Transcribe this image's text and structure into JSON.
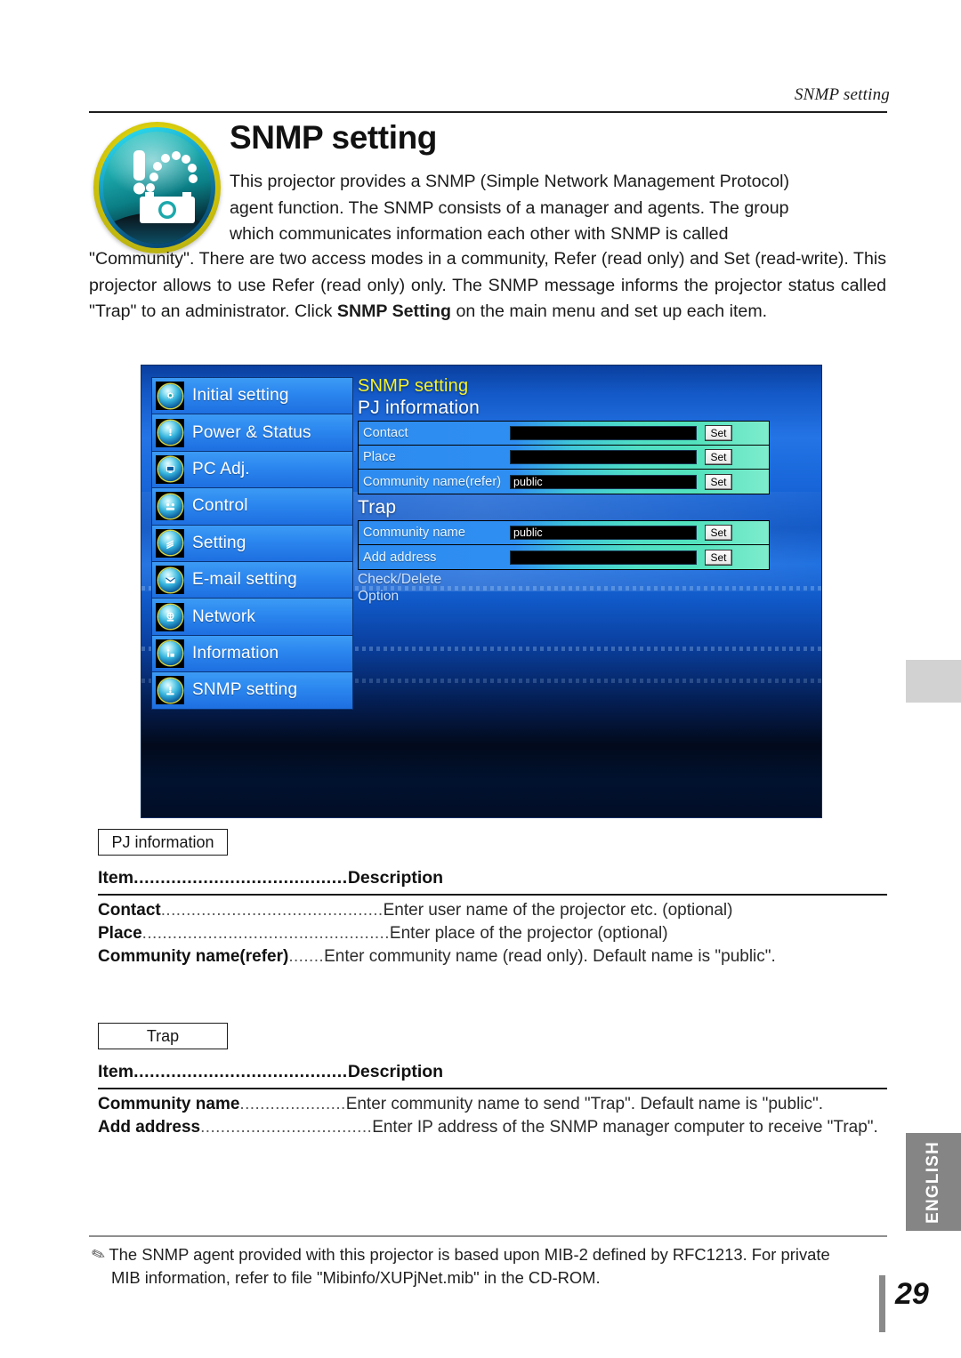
{
  "page": {
    "running_head": "SNMP setting",
    "title": "SNMP setting",
    "number": "29",
    "language_tab": "ENGLISH"
  },
  "intro": {
    "line1": "This projector provides a SNMP (Simple Network Management Protocol)",
    "line2": "agent function. The SNMP consists of a manager and agents. The group",
    "line3": "which communicates information each other with SNMP is called",
    "rest_a": "\"Community\". There are two access modes in a community, Refer (read only) and Set (read-write). This projector allows to use Refer (read only) only. The SNMP message informs the projector status called \"Trap\" to an administrator. Click ",
    "bold": "SNMP Setting",
    "rest_b": " on the main menu and set up each item."
  },
  "screenshot": {
    "sidebar": [
      {
        "label": "Initial setting",
        "icon": "gear-sun-icon"
      },
      {
        "label": "Power & Status",
        "icon": "power-status-icon"
      },
      {
        "label": "PC Adj.",
        "icon": "monitor-icon"
      },
      {
        "label": "Control",
        "icon": "control-icon"
      },
      {
        "label": "Setting",
        "icon": "sliders-icon"
      },
      {
        "label": "E-mail setting",
        "icon": "envelope-icon"
      },
      {
        "label": "Network",
        "icon": "network-icon"
      },
      {
        "label": "Information",
        "icon": "info-icon"
      },
      {
        "label": "SNMP setting",
        "icon": "snmp-icon"
      }
    ],
    "panel_title": "SNMP setting",
    "sections": [
      {
        "heading": "PJ information",
        "rows": [
          {
            "label": "Contact",
            "value": "",
            "button": "Set"
          },
          {
            "label": "Place",
            "value": "",
            "button": "Set"
          },
          {
            "label": "Community name(refer)",
            "value": "public",
            "button": "Set"
          }
        ]
      },
      {
        "heading": "Trap",
        "rows": [
          {
            "label": "Community name",
            "value": "public",
            "button": "Set"
          },
          {
            "label": "Add address",
            "value": "",
            "button": "Set"
          }
        ]
      }
    ],
    "links": [
      "Check/Delete",
      "Option"
    ],
    "colors": {
      "panel_title": "#f5f32b",
      "row_left": "#2e8cf0",
      "row_right": "#7eeccd",
      "field": "#000000",
      "backdrop_top": "#2474e6",
      "backdrop_bottom": "#020d26"
    }
  },
  "tables": [
    {
      "tag": "PJ information",
      "header": {
        "item": "Item",
        "dots": "........................................",
        "description": "Description"
      },
      "rows": [
        {
          "item": "Contact",
          "dots": "............................................",
          "description": "Enter user name of the projector etc. (optional)"
        },
        {
          "item": "Place",
          "dots": ".................................................",
          "description": "Enter place of the projector (optional)"
        },
        {
          "item": "Community name(refer)",
          "dots": ".......",
          "description": "Enter community name (read only). Default name is \"public\"."
        }
      ]
    },
    {
      "tag": "Trap",
      "header": {
        "item": "Item",
        "dots": "........................................",
        "description": "Description"
      },
      "rows": [
        {
          "item": "Community name",
          "dots": ".....................",
          "description": "Enter community name to send \"Trap\". Default name is \"public\"."
        },
        {
          "item": "Add address",
          "dots": "..................................",
          "description": "Enter IP address of the SNMP manager computer to receive \"Trap\"."
        }
      ]
    }
  ],
  "footnote": {
    "icon": "pencil-icon",
    "line1": "The SNMP agent provided with this projector is based upon MIB-2 defined by RFC1213. For private",
    "line2": "MIB information, refer to file \"Mibinfo/XUPjNet.mib\" in the CD-ROM."
  }
}
